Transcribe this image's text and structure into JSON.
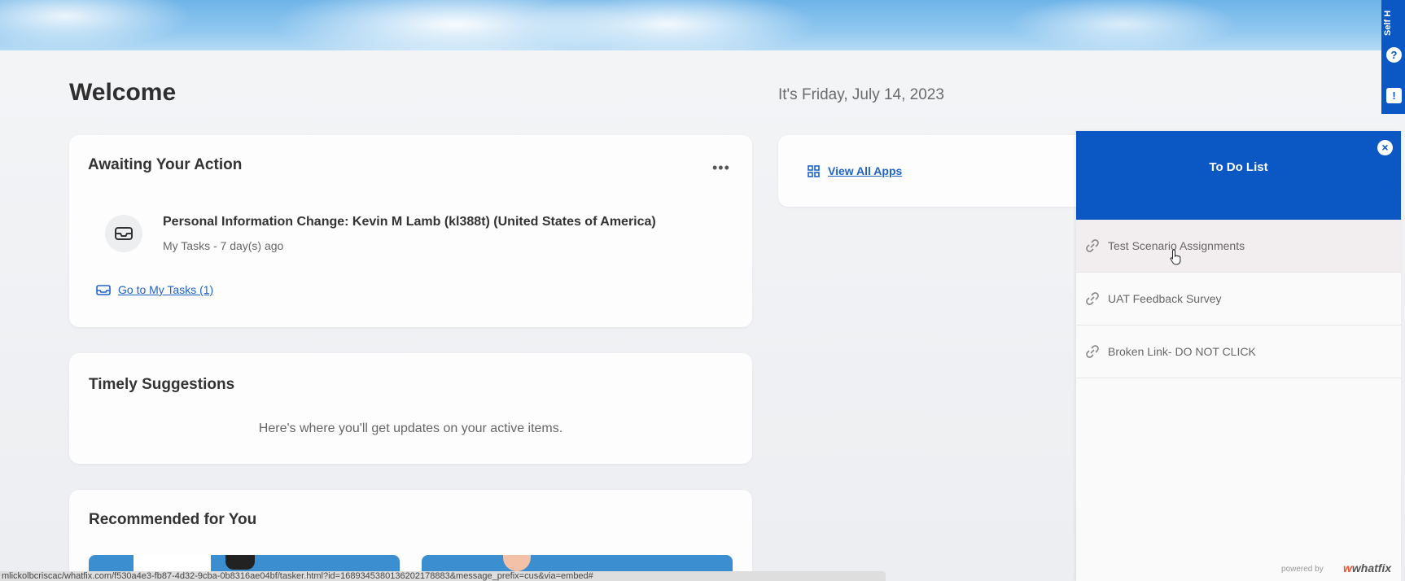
{
  "header": {
    "welcome": "Welcome",
    "date": "It's Friday, July 14, 2023"
  },
  "awaiting": {
    "title": "Awaiting Your Action",
    "more_label": "•••",
    "task_title": "Personal Information Change: Kevin M Lamb (kl388t) (United States of America)",
    "task_sub": "My Tasks - 7 day(s) ago",
    "go_link": "Go to My Tasks (1)"
  },
  "timely": {
    "title": "Timely Suggestions",
    "message": "Here's where you'll get updates on your active items."
  },
  "recommended": {
    "title": "Recommended for You"
  },
  "apps": {
    "link": "View All Apps"
  },
  "rail": {
    "label": "Self H",
    "help_glyph": "?",
    "msg_glyph": "!"
  },
  "todo": {
    "title": "To Do List",
    "close_glyph": "×",
    "items": [
      {
        "label": "Test Scenario Assignments"
      },
      {
        "label": "UAT Feedback Survey"
      },
      {
        "label": "Broken Link- DO NOT CLICK"
      }
    ],
    "powered_by": "powered by",
    "brand": "whatfix"
  },
  "status_bar": {
    "url": "mlickolbcriscac/whatfix.com/f530a4e3-fb87-4d32-9cba-0b8316ae04bf/tasker.html?id=1689345380136202178883&message_prefix=cus&via=embed#"
  },
  "colors": {
    "accent": "#0b57c4",
    "link": "#1f63c6",
    "background": "#eef0f3"
  }
}
